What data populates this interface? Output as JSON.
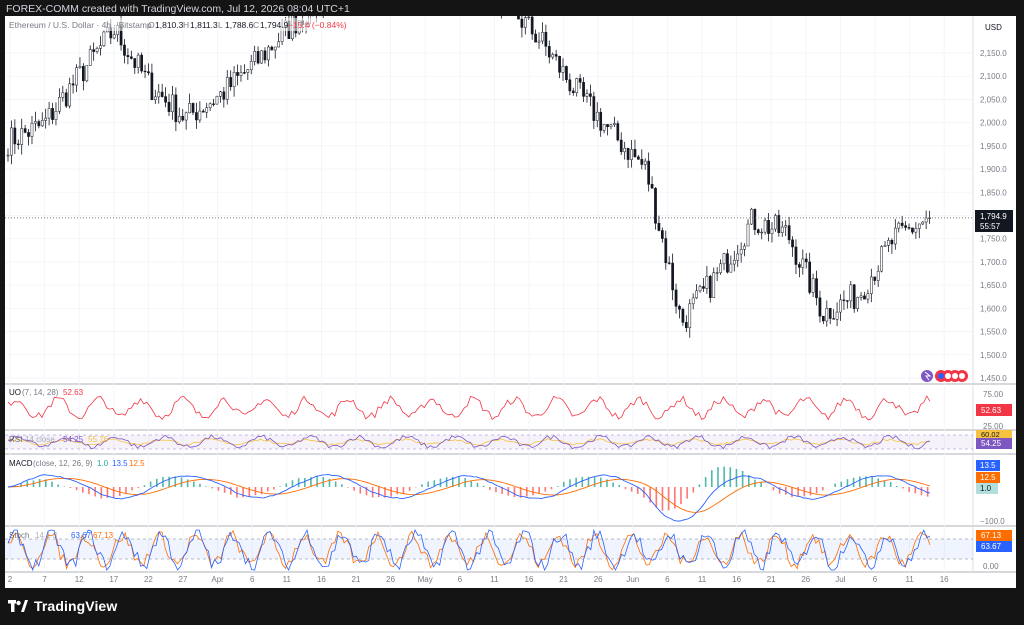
{
  "header": {
    "attribution": "FOREX-COMM created with TradingView.com, Jul 12, 2026 08:04 UTC+1"
  },
  "legend": {
    "symbol": "Ethereum / U.S. Dollar · 4h · Bitstamp",
    "open_label": "O",
    "open": "1,810.3",
    "high_label": "H",
    "high": "1,811.3",
    "low_label": "L",
    "low": "1,788.6",
    "close_label": "C",
    "close": "1,794.9",
    "change": "−15.4 (−0.84%)"
  },
  "price_axis": {
    "currency": "USD",
    "ticks": [
      "2,150.0",
      "2,100.0",
      "2,050.0",
      "2,000.0",
      "1,950.0",
      "1,900.0",
      "1,850.0",
      "1,800.0",
      "1,750.0",
      "1,700.0",
      "1,650.0",
      "1,600.0",
      "1,550.0",
      "1,500.0",
      "1,450.0"
    ],
    "last_price": "1,794.9",
    "countdown": "55:57"
  },
  "panes": {
    "uo": {
      "label": "UO",
      "params": "(7, 14, 28)",
      "value": "52.63",
      "ticks": [
        "75.00",
        "25.00"
      ],
      "badge": "52.63",
      "color": "#f23645"
    },
    "rsi": {
      "label": "RSI",
      "params": "14 close",
      "value_a": "54.25",
      "value_b": "55.76",
      "badge_top": "60.02",
      "badge": "54.25",
      "color": "#7e57c2",
      "ma_color": "#f7c23f"
    },
    "macd": {
      "label": "MACD",
      "params": "(close, 12, 26, 9)",
      "hist": "1.0",
      "macd": "13.5",
      "signal": "12.5",
      "badge_macd": "13.5",
      "badge_signal": "12.5",
      "badge_hist": "1.0",
      "tick_bottom": "−100.0",
      "macd_color": "#2962ff",
      "signal_color": "#ff6d00"
    },
    "stoch": {
      "label": "Stoch",
      "params": "14 1 3",
      "k": "63.67",
      "d": "67.13",
      "badge_d": "67.13",
      "badge_k": "63.67",
      "tick_bottom": "0.00",
      "k_color": "#2962ff",
      "d_color": "#ff6d00"
    }
  },
  "time_axis": [
    {
      "label": "2"
    },
    {
      "label": "7"
    },
    {
      "label": "12"
    },
    {
      "label": "17"
    },
    {
      "label": "22"
    },
    {
      "label": "27"
    },
    {
      "label": "Apr"
    },
    {
      "label": "6"
    },
    {
      "label": "11"
    },
    {
      "label": "16"
    },
    {
      "label": "21"
    },
    {
      "label": "26"
    },
    {
      "label": "May"
    },
    {
      "label": "6"
    },
    {
      "label": "11"
    },
    {
      "label": "16"
    },
    {
      "label": "21"
    },
    {
      "label": "26"
    },
    {
      "label": "Jun"
    },
    {
      "label": "6"
    },
    {
      "label": "11"
    },
    {
      "label": "16"
    },
    {
      "label": "21"
    },
    {
      "label": "26"
    },
    {
      "label": "Jul"
    },
    {
      "label": "6"
    },
    {
      "label": "11"
    },
    {
      "label": "16"
    }
  ],
  "footer": {
    "brand": "TradingView"
  },
  "colors": {
    "candle": "#131722",
    "accent": "#2962ff",
    "page": "#141414",
    "chart_bg": "#ffffff"
  },
  "chart_data": {
    "type": "line",
    "title": "Ethereum / U.S. Dollar · 4h · Bitstamp",
    "ylabel": "USD",
    "ylim": [
      1450,
      2200
    ],
    "x": [
      "Mar 2",
      "Mar 7",
      "Mar 12",
      "Mar 17",
      "Mar 22",
      "Mar 27",
      "Apr 1",
      "Apr 6",
      "Apr 11",
      "Apr 16",
      "Apr 21",
      "Apr 26",
      "May 1",
      "May 6",
      "May 11",
      "May 16",
      "May 21",
      "May 26",
      "Jun 1",
      "Jun 6",
      "Jun 11",
      "Jun 16",
      "Jun 21",
      "Jun 26",
      "Jul 1",
      "Jul 6",
      "Jul 11"
    ],
    "series": [
      {
        "name": "ETHUSD",
        "values": [
          1960,
          1995,
          2100,
          2200,
          2080,
          2010,
          2060,
          2130,
          2210,
          2280,
          2320,
          2330,
          2300,
          2300,
          2260,
          2180,
          2070,
          1980,
          1900,
          1570,
          1670,
          1790,
          1760,
          1590,
          1630,
          1750,
          1795
        ]
      }
    ],
    "grid": true
  }
}
